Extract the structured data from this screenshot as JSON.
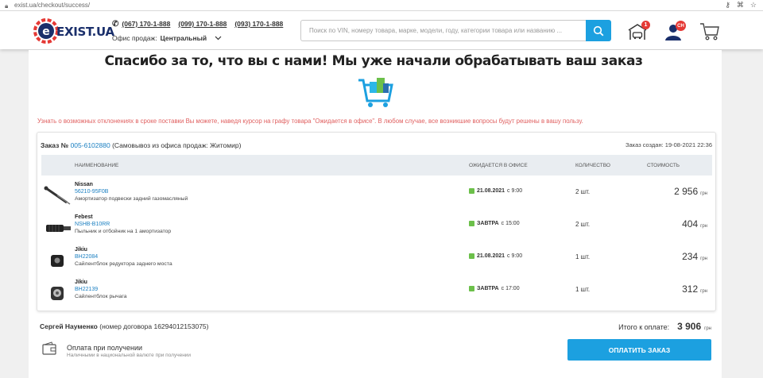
{
  "browser": {
    "url": "exist.ua/checkout/success/"
  },
  "header": {
    "logo_text": "EXIST.UA",
    "phones": [
      "(067) 170-1-888",
      "(099) 170-1-888",
      "(093) 170-1-888"
    ],
    "office_label": "Офис продаж:",
    "office_value": "Центральный",
    "search_placeholder": "Поиск по VIN, номеру товара, марке, модели, году, категории товара или названию ...",
    "garage_badge": "1",
    "profile_badge": "СН"
  },
  "main": {
    "title": "Спасибо за то, что вы с нами! Мы уже начали обрабатывать ваш заказ",
    "notice": "Узнать о возможных отклонениях в сроке поставки Вы можете, наведя курсор на графу товара \"Ожидается в офисе\". В любом случае, все возникшие вопросы будут решены в вашу пользу."
  },
  "order": {
    "label": "Заказ №",
    "number": "005-6102880",
    "pickup": "(Самовывоз из офиса продаж: Житомир)",
    "created": "Заказ создан: 19-08-2021 22:36",
    "columns": {
      "name": "НАИМЕНОВАНИЕ",
      "expected": "ОЖИДАЕТСЯ В ОФИСЕ",
      "qty": "КОЛИЧЕСТВО",
      "cost": "СТОИМОСТЬ"
    },
    "items": [
      {
        "brand": "Nissan",
        "code": "56210-95F0B",
        "desc": "Амортизатор подвески задний газомасляный",
        "exp_date": "21.08.2021",
        "exp_time": "с 9:00",
        "qty": "2 шт.",
        "price": "2 956",
        "currency": "грн"
      },
      {
        "brand": "Febest",
        "code": "NSHB-B10RR",
        "desc": "Пыльник и отбойник на 1 амортизатор",
        "exp_date": "ЗАВТРА",
        "exp_time": "с 15:00",
        "qty": "2 шт.",
        "price": "404",
        "currency": "грн"
      },
      {
        "brand": "Jikiu",
        "code": "BH22084",
        "desc": "Сайлентблок редуктора заднего моста",
        "exp_date": "21.08.2021",
        "exp_time": "с 9:00",
        "qty": "1 шт.",
        "price": "234",
        "currency": "грн"
      },
      {
        "brand": "Jikiu",
        "code": "BH22139",
        "desc": "Сайлентблок рычага",
        "exp_date": "ЗАВТРА",
        "exp_time": "с 17:00",
        "qty": "1 шт.",
        "price": "312",
        "currency": "грн"
      }
    ]
  },
  "footer": {
    "customer_name": "Сергей Науменко",
    "contract": "(номер договора 16294012153075)",
    "total_label": "Итого к оплате:",
    "total_value": "3 906",
    "total_currency": "грн",
    "payment_title": "Оплата при получении",
    "payment_sub": "Наличными в национальной валюте при получении",
    "pay_button": "ОПЛАТИТЬ ЗАКАЗ"
  },
  "colors": {
    "accent": "#1ca0e0",
    "brand_navy": "#1a2f6b",
    "brand_red": "#e53935",
    "notice": "#e06060",
    "status_green": "#6cc04a"
  }
}
